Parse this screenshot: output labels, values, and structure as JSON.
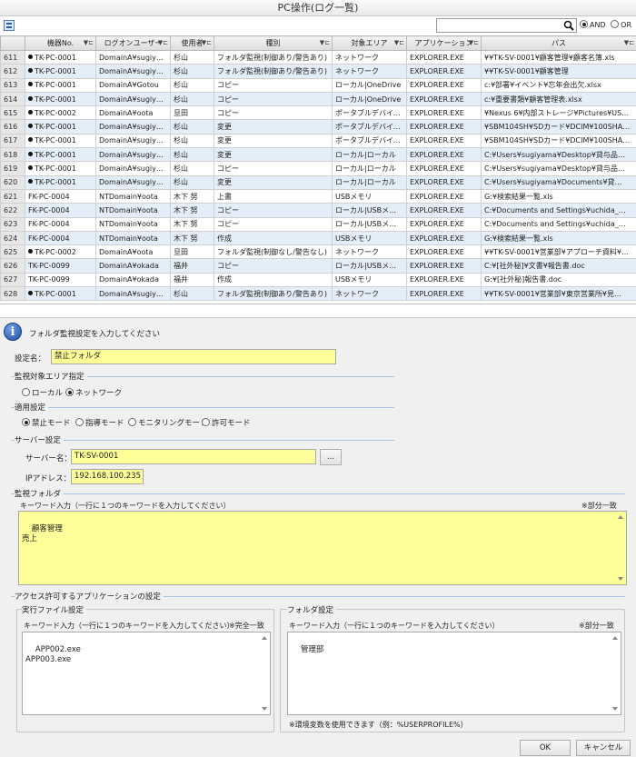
{
  "log": {
    "title": "PC操作(ログ一覧)",
    "search_placeholder": "",
    "match_and": "AND",
    "match_or": "OR",
    "columns": [
      "",
      "機器No.",
      "ログオンユーザー",
      "使用者",
      "種別",
      "対象エリア",
      "アプリケーション",
      "パス"
    ],
    "rows": [
      [
        "611",
        "●TK-PC-0001",
        "DomainA¥sugiy…",
        "杉山",
        "フォルダ監視(制御あり/警告あり)",
        "ネットワーク",
        "EXPLORER.EXE",
        "¥¥TK-SV-0001¥顧客管理¥顧客名簿.xls"
      ],
      [
        "612",
        "●TK-PC-0001",
        "DomainA¥sugiy…",
        "杉山",
        "フォルダ監視(制御あり/警告あり)",
        "ネットワーク",
        "EXPLORER.EXE",
        "¥¥TK-SV-0001¥顧客管理"
      ],
      [
        "613",
        "●TK-PC-0001",
        "DomainA¥Gotou",
        "杉山",
        "コピー",
        "ローカル|OneDrive",
        "EXPLORER.EXE",
        "c:¥部署¥イベント¥忘年会出欠.xlsx"
      ],
      [
        "614",
        "●TK-PC-0001",
        "DomainA¥sugiy…",
        "杉山",
        "コピー",
        "ローカル|OneDrive",
        "EXPLORER.EXE",
        "c:¥重要書類¥顧客管理表.xlsx"
      ],
      [
        "615",
        "●TK-PC-0002",
        "DomainA¥oota",
        "旦田",
        "コピー",
        "ポータブルデバイス(…",
        "EXPLORER.EXE",
        "¥Nexus 6¥内部ストレージ¥Pictures¥US…"
      ],
      [
        "616",
        "●TK-PC-0001",
        "DomainA¥sugiy…",
        "杉山",
        "変更",
        "ポータブルデバイス(…",
        "EXPLORER.EXE",
        "¥SBM104SH¥SDカード¥DCIM¥100SHA…"
      ],
      [
        "617",
        "●TK-PC-0001",
        "DomainA¥sugiy…",
        "杉山",
        "変更",
        "ポータブルデバイス(…",
        "EXPLORER.EXE",
        "¥SBM104SH¥SDカード¥DCIM¥100SHA…"
      ],
      [
        "618",
        "●TK-PC-0001",
        "DomainA¥sugiy…",
        "杉山",
        "変更",
        "ローカル|ローカル",
        "EXPLORER.EXE",
        "C:¥Users¥sugiyama¥Desktop¥貸与品…"
      ],
      [
        "619",
        "●TK-PC-0001",
        "DomainA¥sugiy…",
        "杉山",
        "コピー",
        "ローカル|ローカル",
        "EXPLORER.EXE",
        "C:¥Users¥sugiyama¥Desktop¥貸与品…"
      ],
      [
        "620",
        "●TK-PC-0001",
        "DomainA¥sugiy…",
        "杉山",
        "変更",
        "ローカル|ローカル",
        "EXPLORER.EXE",
        "C:¥Users¥sugiyama¥Documents¥貸…"
      ],
      [
        "621",
        "FK-PC-0004",
        "NTDomain¥oota",
        "木下 努",
        "上書",
        "USBメモリ",
        "EXPLORER.EXE",
        "G:¥検索結果一覧.xls"
      ],
      [
        "622",
        "FK-PC-0004",
        "NTDomain¥oota",
        "木下 努",
        "コピー",
        "ローカル|USBメモリ",
        "EXPLORER.EXE",
        "C:¥Documents and Settings¥uchida_…"
      ],
      [
        "623",
        "FK-PC-0004",
        "NTDomain¥oota",
        "木下 努",
        "コピー",
        "ローカル|USBメモリ",
        "EXPLORER.EXE",
        "C:¥Documents and Settings¥uchida_…"
      ],
      [
        "624",
        "FK-PC-0004",
        "NTDomain¥oota",
        "木下 努",
        "作成",
        "USBメモリ",
        "EXPLORER.EXE",
        "G:¥検索結果一覧.xls"
      ],
      [
        "625",
        "●TK-PC-0002",
        "DomainA¥oota",
        "旦田",
        "フォルダ監視(制御なし/警告なし)",
        "ネットワーク",
        "EXPLORER.EXE",
        "¥¥TK-SV-0001¥営業部¥アプローチ資料¥…"
      ],
      [
        "626",
        "TK-PC-0099",
        "DomainA¥okada",
        "福井",
        "コピー",
        "ローカル|USBメモリ",
        "EXPLORER.EXE",
        "C:¥[社外秘]¥文書¥報告書.doc"
      ],
      [
        "627",
        "TK-PC-0099",
        "DomainA¥okada",
        "福井",
        "作成",
        "USBメモリ",
        "EXPLORER.EXE",
        "G:¥[社外秘]報告書.doc"
      ],
      [
        "628",
        "●TK-PC-0001",
        "DomainA¥sugiy…",
        "杉山",
        "フォルダ監視(制御あり/警告あり)",
        "ネットワーク",
        "EXPLORER.EXE",
        "¥¥TK-SV-0001¥営業部¥東京営業所¥見…"
      ]
    ]
  },
  "dialog": {
    "message": "フォルダ監視設定を入力してください",
    "setting_name_label": "設定名：",
    "setting_name_value": "禁止フォルダ",
    "area_section": "監視対象エリア指定",
    "area_local": "ローカル",
    "area_network": "ネットワーク",
    "apply_section": "適用設定",
    "mode_prohibit": "禁止モード",
    "mode_guide": "指導モード",
    "mode_monitor": "モニタリングモード",
    "mode_allow": "許可モード",
    "server_section": "サーバー設定",
    "server_name_label": "サーバー名：",
    "server_name_value": "TK-SV-0001",
    "browse_label": "...",
    "ip_label": "IPアドレス：",
    "ip_value": "192.168.100.235",
    "folder_section": "監視フォルダ",
    "keyword_label": "キーワード入力（一行に１つのキーワードを入力してください）",
    "partial_match": "※部分一致",
    "folder_keywords": "顧客管理\n売上",
    "app_section": "アクセス許可するアプリケーションの設定",
    "exe_group": "実行ファイル設定",
    "exact_match": "※完全一致",
    "exe_keywords": "APP002.exe\nAPP003.exe",
    "folder_group": "フォルダ設定",
    "app_folder_keywords": "管理部",
    "env_note": "※環境変数を使用できます（例：%USERPROFILE%）",
    "ok_label": "OK",
    "cancel_label": "キャンセル"
  }
}
